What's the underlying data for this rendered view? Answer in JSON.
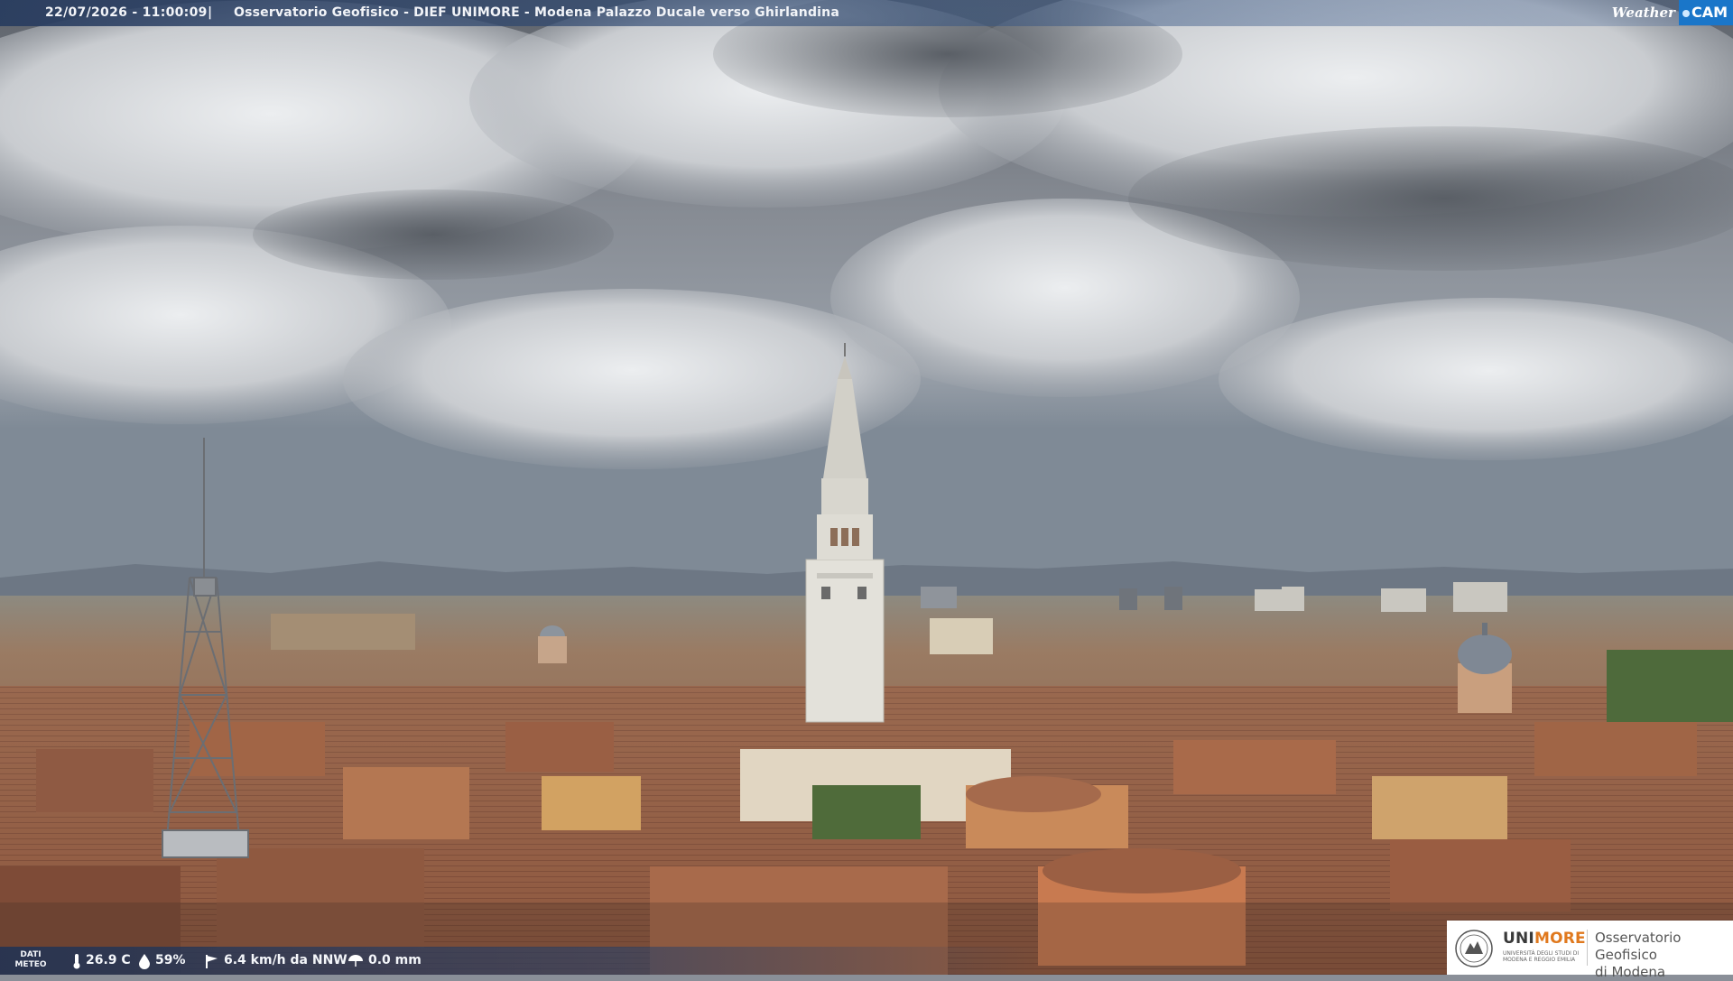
{
  "header": {
    "timestamp": "22/07/2026 - 11:00:09",
    "separator": "|",
    "title": "Osservatorio Geofisico - DIEF UNIMORE - Modena Palazzo Ducale verso Ghirlandina"
  },
  "brand": {
    "weather_text": "Weather",
    "cam_text": "CAM"
  },
  "meteo": {
    "label_line1": "DATI",
    "label_line2": "METEO",
    "temperature": "26.9 C",
    "humidity": "59%",
    "wind": "6.4 km/h da NNW",
    "rain": "0.0 mm",
    "icons": [
      "thermometer-icon",
      "humidity-drop-icon",
      "wind-flag-icon",
      "rain-umbrella-icon"
    ]
  },
  "logo": {
    "uni": "UNI",
    "more": "MORE",
    "university_line1": "UNIVERSITÀ DEGLI STUDI DI",
    "university_line2": "MODENA E REGGIO EMILIA",
    "obs_line1": "Osservatorio Geofisico",
    "obs_line2": "di Modena"
  },
  "colors": {
    "sky_top": "#6f747c",
    "cloud": "#e6e8ea",
    "roof": "#a5674a",
    "tower": "#e4e2dc",
    "accent_orange": "#e0791e",
    "brand_blue": "#1a76c9"
  }
}
